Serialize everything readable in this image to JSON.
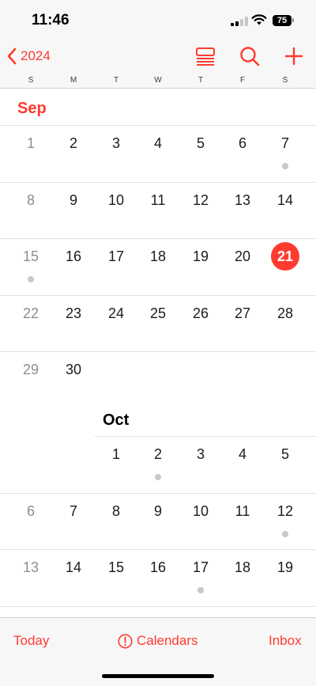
{
  "status": {
    "time": "11:46",
    "battery": "75"
  },
  "nav": {
    "back_label": "2024"
  },
  "weekdays": [
    "S",
    "M",
    "T",
    "W",
    "T",
    "F",
    "S"
  ],
  "months": [
    {
      "name": "Sep",
      "weeks": [
        {
          "days": [
            {
              "n": "1",
              "col": 0,
              "weekend": true
            },
            {
              "n": "2",
              "col": 1
            },
            {
              "n": "3",
              "col": 2
            },
            {
              "n": "4",
              "col": 3
            },
            {
              "n": "5",
              "col": 4
            },
            {
              "n": "6",
              "col": 5
            },
            {
              "n": "7",
              "col": 6,
              "event": true
            }
          ]
        },
        {
          "days": [
            {
              "n": "8",
              "col": 0,
              "weekend": true
            },
            {
              "n": "9",
              "col": 1
            },
            {
              "n": "10",
              "col": 2
            },
            {
              "n": "11",
              "col": 3
            },
            {
              "n": "12",
              "col": 4
            },
            {
              "n": "13",
              "col": 5
            },
            {
              "n": "14",
              "col": 6
            }
          ]
        },
        {
          "days": [
            {
              "n": "15",
              "col": 0,
              "weekend": true,
              "event": true
            },
            {
              "n": "16",
              "col": 1
            },
            {
              "n": "17",
              "col": 2
            },
            {
              "n": "18",
              "col": 3
            },
            {
              "n": "19",
              "col": 4
            },
            {
              "n": "20",
              "col": 5
            },
            {
              "n": "21",
              "col": 6,
              "today": true
            }
          ]
        },
        {
          "days": [
            {
              "n": "22",
              "col": 0,
              "weekend": true
            },
            {
              "n": "23",
              "col": 1
            },
            {
              "n": "24",
              "col": 2
            },
            {
              "n": "25",
              "col": 3
            },
            {
              "n": "26",
              "col": 4
            },
            {
              "n": "27",
              "col": 5
            },
            {
              "n": "28",
              "col": 6
            }
          ]
        },
        {
          "days": [
            {
              "n": "29",
              "col": 0,
              "weekend": true
            },
            {
              "n": "30",
              "col": 1
            }
          ]
        }
      ]
    },
    {
      "name": "Oct",
      "weeks": [
        {
          "days": [
            {
              "n": "1",
              "col": 2
            },
            {
              "n": "2",
              "col": 3,
              "event": true
            },
            {
              "n": "3",
              "col": 4
            },
            {
              "n": "4",
              "col": 5
            },
            {
              "n": "5",
              "col": 6
            }
          ]
        },
        {
          "days": [
            {
              "n": "6",
              "col": 0,
              "weekend": true
            },
            {
              "n": "7",
              "col": 1
            },
            {
              "n": "8",
              "col": 2
            },
            {
              "n": "9",
              "col": 3
            },
            {
              "n": "10",
              "col": 4
            },
            {
              "n": "11",
              "col": 5
            },
            {
              "n": "12",
              "col": 6,
              "event": true
            }
          ]
        },
        {
          "days": [
            {
              "n": "13",
              "col": 0,
              "weekend": true
            },
            {
              "n": "14",
              "col": 1
            },
            {
              "n": "15",
              "col": 2
            },
            {
              "n": "16",
              "col": 3
            },
            {
              "n": "17",
              "col": 4,
              "event": true
            },
            {
              "n": "18",
              "col": 5
            },
            {
              "n": "19",
              "col": 6
            }
          ]
        }
      ]
    }
  ],
  "tabs": {
    "today": "Today",
    "calendars": "Calendars",
    "inbox": "Inbox"
  },
  "colors": {
    "accent": "#ff3b30",
    "weekend_text": "#8e8e93",
    "event_dot": "#c7c7cc"
  }
}
